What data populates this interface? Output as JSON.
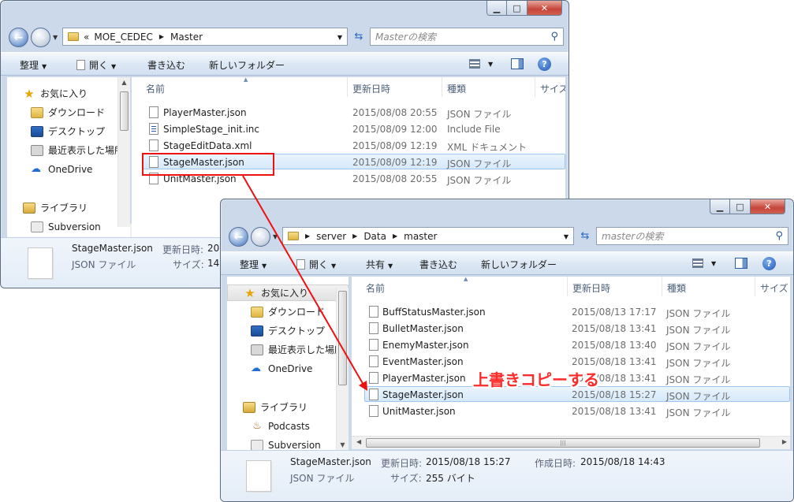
{
  "window1": {
    "path": [
      "MOE_CEDEC",
      "Master"
    ],
    "path_prefix": "«",
    "search_placeholder": "Masterの検索",
    "toolbar": {
      "organize": "整理",
      "open": "開く",
      "burn": "書き込む",
      "new_folder": "新しいフォルダー"
    },
    "columns": {
      "name": "名前",
      "date": "更新日時",
      "type": "種類",
      "size": "サイズ"
    },
    "nav": [
      {
        "label": "お気に入り",
        "icon": "star-icon"
      },
      {
        "label": "ダウンロード",
        "icon": "downloads-folder-icon"
      },
      {
        "label": "デスクトップ",
        "icon": "desktop-icon"
      },
      {
        "label": "最近表示した場所",
        "icon": "recent-places-icon"
      },
      {
        "label": "OneDrive",
        "icon": "onedrive-icon"
      },
      {
        "label": "ライブラリ",
        "icon": "library-icon"
      },
      {
        "label": "Subversion",
        "icon": "subversion-icon"
      }
    ],
    "files": [
      {
        "name": "PlayerMaster.json",
        "date": "2015/08/08 20:55",
        "type": "JSON ファイル"
      },
      {
        "name": "SimpleStage_init.inc",
        "date": "2015/08/09 12:00",
        "type": "Include File"
      },
      {
        "name": "StageEditData.xml",
        "date": "2015/08/09 12:19",
        "type": "XML ドキュメント"
      },
      {
        "name": "StageMaster.json",
        "date": "2015/08/09 12:19",
        "type": "JSON ファイル"
      },
      {
        "name": "UnitMaster.json",
        "date": "2015/08/08 20:55",
        "type": "JSON ファイル"
      }
    ],
    "details": {
      "filename": "StageMaster.json",
      "modified_label": "更新日時:",
      "modified_value": "20",
      "type": "JSON ファイル",
      "size_label": "サイズ:",
      "size_value": "14"
    }
  },
  "window2": {
    "path": [
      "server",
      "Data",
      "master"
    ],
    "search_placeholder": "masterの検索",
    "toolbar": {
      "organize": "整理",
      "open": "開く",
      "share": "共有",
      "burn": "書き込む",
      "new_folder": "新しいフォルダー"
    },
    "columns": {
      "name": "名前",
      "date": "更新日時",
      "type": "種類",
      "size": "サイズ"
    },
    "nav": [
      {
        "label": "お気に入り",
        "icon": "star-icon"
      },
      {
        "label": "ダウンロード",
        "icon": "downloads-folder-icon"
      },
      {
        "label": "デスクトップ",
        "icon": "desktop-icon"
      },
      {
        "label": "最近表示した場所",
        "icon": "recent-places-icon"
      },
      {
        "label": "OneDrive",
        "icon": "onedrive-icon"
      },
      {
        "label": "ライブラリ",
        "icon": "library-icon"
      },
      {
        "label": "Podcasts",
        "icon": "podcast-icon"
      },
      {
        "label": "Subversion",
        "icon": "subversion-icon"
      }
    ],
    "files": [
      {
        "name": "BuffStatusMaster.json",
        "date": "2015/08/13 17:17",
        "type": "JSON ファイル"
      },
      {
        "name": "BulletMaster.json",
        "date": "2015/08/18 13:41",
        "type": "JSON ファイル"
      },
      {
        "name": "EnemyMaster.json",
        "date": "2015/08/18 13:40",
        "type": "JSON ファイル"
      },
      {
        "name": "EventMaster.json",
        "date": "2015/08/18 13:41",
        "type": "JSON ファイル"
      },
      {
        "name": "PlayerMaster.json",
        "date": "2015/08/18 13:41",
        "type": "JSON ファイル"
      },
      {
        "name": "StageMaster.json",
        "date": "2015/08/18 15:27",
        "type": "JSON ファイル"
      },
      {
        "name": "UnitMaster.json",
        "date": "2015/08/18 13:41",
        "type": "JSON ファイル"
      }
    ],
    "details": {
      "filename": "StageMaster.json",
      "modified_label": "更新日時:",
      "modified_value": "2015/08/18 15:27",
      "created_label": "作成日時:",
      "created_value": "2015/08/18 14:43",
      "type": "JSON ファイル",
      "size_label": "サイズ:",
      "size_value": "255 バイト"
    }
  },
  "annotation": {
    "label": "上書きコピーする",
    "color": "#ff2a2a"
  }
}
